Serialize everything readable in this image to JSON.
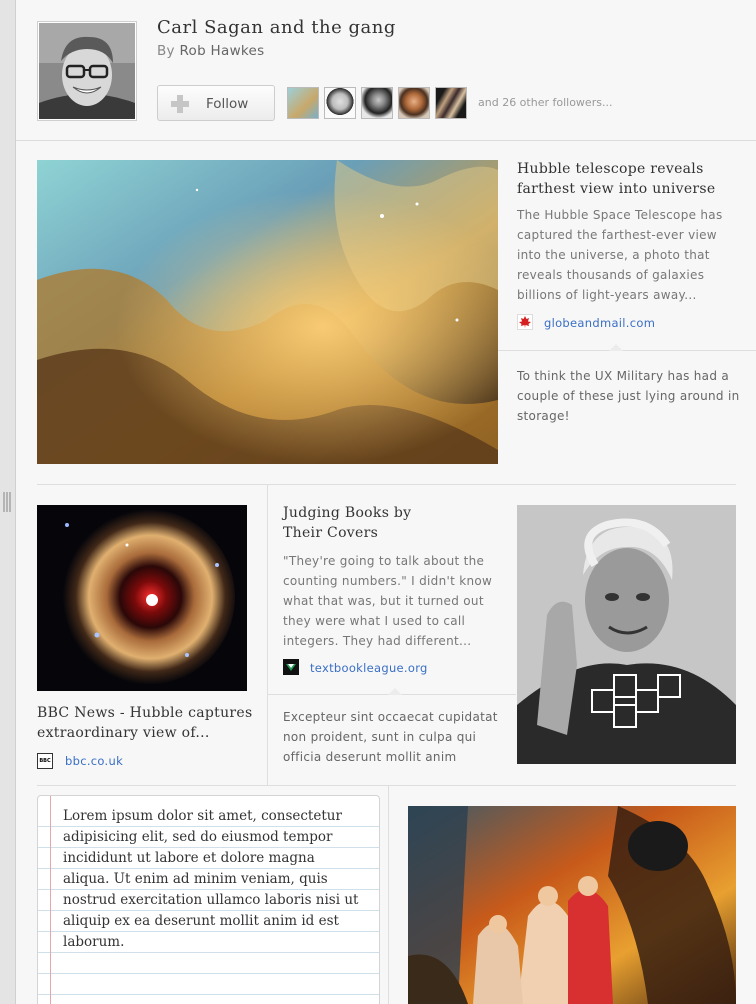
{
  "header": {
    "title": "Carl Sagan and the gang",
    "by_prefix": "By",
    "author": "Rob Hawkes",
    "follow_label": "Follow",
    "followers_text": "and 26 other followers..."
  },
  "cards": {
    "hubble": {
      "title": "Hubble telescope reveals farthest view into universe",
      "description": "The Hubble Space Telescope has captured the farthest-ever view into the universe, a photo that reveals thousands of galaxies billions of light-years away...",
      "source": "globeandmail.com",
      "comment": "To think the UX Military has had a couple of these just lying around in storage!"
    },
    "bbc": {
      "title": "BBC News - Hubble captures extraordinary view of...",
      "source": "bbc.co.uk",
      "source_icon_text": "BBC"
    },
    "books": {
      "title": "Judging Books by Their Covers",
      "description": "\"They're going to talk about the counting numbers.\" I didn't know what that was, but it turned out they were what I used to call integers. They had different...",
      "source": "textbookleague.org",
      "comment": "Excepteur sint occaecat cupidatat non proident, sunt in culpa qui officia deserunt mollit anim"
    },
    "note": {
      "text": "Lorem ipsum dolor sit amet, consectetur adipisicing elit, sed do eiusmod tempor incididunt ut labore et dolore magna aliqua. Ut enim ad minim veniam, quis nostrud exercitation ullamco laboris nisi ut aliquip ex ea deserunt mollit anim id est laborum."
    }
  },
  "colors": {
    "link": "#3a6fc4",
    "globe_leaf": "#d42020",
    "textbook_icon": "#1f9a55"
  }
}
